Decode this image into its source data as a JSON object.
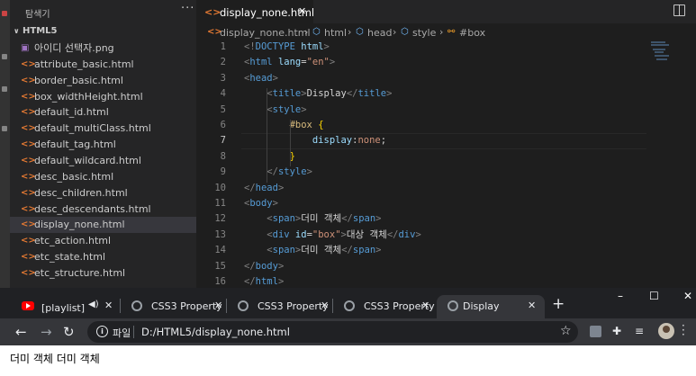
{
  "vscode": {
    "sidebar": {
      "title": "탐색기",
      "more": "···",
      "section": "HTML5",
      "files": [
        {
          "icon": "image-file-icon",
          "name": "아이디 선택자.png"
        },
        {
          "icon": "html-file-icon",
          "name": "attribute_basic.html"
        },
        {
          "icon": "html-file-icon",
          "name": "border_basic.html"
        },
        {
          "icon": "html-file-icon",
          "name": "box_widthHeight.html"
        },
        {
          "icon": "html-file-icon",
          "name": "default_id.html"
        },
        {
          "icon": "html-file-icon",
          "name": "default_multiClass.html"
        },
        {
          "icon": "html-file-icon",
          "name": "default_tag.html"
        },
        {
          "icon": "html-file-icon",
          "name": "default_wildcard.html"
        },
        {
          "icon": "html-file-icon",
          "name": "desc_basic.html"
        },
        {
          "icon": "html-file-icon",
          "name": "desc_children.html"
        },
        {
          "icon": "html-file-icon",
          "name": "desc_descendants.html"
        },
        {
          "icon": "html-file-icon",
          "name": "display_none.html",
          "selected": true
        },
        {
          "icon": "html-file-icon",
          "name": "etc_action.html"
        },
        {
          "icon": "html-file-icon",
          "name": "etc_state.html"
        },
        {
          "icon": "html-file-icon",
          "name": "etc_structure.html"
        }
      ]
    },
    "tab": {
      "label": "display_none.html",
      "close": "✕"
    },
    "breadcrumb": [
      "display_none.html",
      "html",
      "head",
      "style",
      "#box"
    ],
    "current_line": 7,
    "code": [
      {
        "n": "1",
        "tokens": [
          [
            "t-bracket",
            "<!"
          ],
          [
            "t-tag",
            "DOCTYPE"
          ],
          [
            "t-text",
            " "
          ],
          [
            "t-attr",
            "html"
          ],
          [
            "t-bracket",
            ">"
          ]
        ]
      },
      {
        "n": "2",
        "tokens": [
          [
            "t-bracket",
            "<"
          ],
          [
            "t-tag",
            "html"
          ],
          [
            "t-text",
            " "
          ],
          [
            "t-attr",
            "lang"
          ],
          [
            "t-text",
            "="
          ],
          [
            "t-str",
            "\"en\""
          ],
          [
            "t-bracket",
            ">"
          ]
        ]
      },
      {
        "n": "3",
        "tokens": [
          [
            "t-bracket",
            "<"
          ],
          [
            "t-tag",
            "head"
          ],
          [
            "t-bracket",
            ">"
          ]
        ]
      },
      {
        "n": "4",
        "tokens": [
          [
            "t-text",
            "    "
          ],
          [
            "t-bracket",
            "<"
          ],
          [
            "t-tag",
            "title"
          ],
          [
            "t-bracket",
            ">"
          ],
          [
            "t-text",
            "Display"
          ],
          [
            "t-bracket",
            "</"
          ],
          [
            "t-tag",
            "title"
          ],
          [
            "t-bracket",
            ">"
          ]
        ]
      },
      {
        "n": "5",
        "tokens": [
          [
            "t-text",
            "    "
          ],
          [
            "t-bracket",
            "<"
          ],
          [
            "t-tag",
            "style"
          ],
          [
            "t-bracket",
            ">"
          ]
        ]
      },
      {
        "n": "6",
        "tokens": [
          [
            "t-text",
            "        "
          ],
          [
            "t-sel",
            "#box"
          ],
          [
            "t-text",
            " "
          ],
          [
            "t-brace",
            "{"
          ]
        ]
      },
      {
        "n": "7",
        "tokens": [
          [
            "t-text",
            "            "
          ],
          [
            "t-prop",
            "display"
          ],
          [
            "t-text",
            ":"
          ],
          [
            "t-val",
            "none"
          ],
          [
            "t-text",
            ";"
          ]
        ]
      },
      {
        "n": "8",
        "tokens": [
          [
            "t-text",
            "        "
          ],
          [
            "t-brace",
            "}"
          ]
        ]
      },
      {
        "n": "9",
        "tokens": [
          [
            "t-text",
            "    "
          ],
          [
            "t-bracket",
            "</"
          ],
          [
            "t-tag",
            "style"
          ],
          [
            "t-bracket",
            ">"
          ]
        ]
      },
      {
        "n": "10",
        "tokens": [
          [
            "t-bracket",
            "</"
          ],
          [
            "t-tag",
            "head"
          ],
          [
            "t-bracket",
            ">"
          ]
        ]
      },
      {
        "n": "11",
        "tokens": [
          [
            "t-bracket",
            "<"
          ],
          [
            "t-tag",
            "body"
          ],
          [
            "t-bracket",
            ">"
          ]
        ]
      },
      {
        "n": "12",
        "tokens": [
          [
            "t-text",
            "    "
          ],
          [
            "t-bracket",
            "<"
          ],
          [
            "t-tag",
            "span"
          ],
          [
            "t-bracket",
            ">"
          ],
          [
            "t-text",
            "더미 객체"
          ],
          [
            "t-bracket",
            "</"
          ],
          [
            "t-tag",
            "span"
          ],
          [
            "t-bracket",
            ">"
          ]
        ]
      },
      {
        "n": "13",
        "tokens": [
          [
            "t-text",
            "    "
          ],
          [
            "t-bracket",
            "<"
          ],
          [
            "t-tag",
            "div"
          ],
          [
            "t-text",
            " "
          ],
          [
            "t-attr",
            "id"
          ],
          [
            "t-text",
            "="
          ],
          [
            "t-str",
            "\"box\""
          ],
          [
            "t-bracket",
            ">"
          ],
          [
            "t-text",
            "대상 객체"
          ],
          [
            "t-bracket",
            "</"
          ],
          [
            "t-tag",
            "div"
          ],
          [
            "t-bracket",
            ">"
          ]
        ]
      },
      {
        "n": "14",
        "tokens": [
          [
            "t-text",
            "    "
          ],
          [
            "t-bracket",
            "<"
          ],
          [
            "t-tag",
            "span"
          ],
          [
            "t-bracket",
            ">"
          ],
          [
            "t-text",
            "더미 객체"
          ],
          [
            "t-bracket",
            "</"
          ],
          [
            "t-tag",
            "span"
          ],
          [
            "t-bracket",
            ">"
          ]
        ]
      },
      {
        "n": "15",
        "tokens": [
          [
            "t-bracket",
            "</"
          ],
          [
            "t-tag",
            "body"
          ],
          [
            "t-bracket",
            ">"
          ]
        ]
      },
      {
        "n": "16",
        "tokens": [
          [
            "t-bracket",
            "</"
          ],
          [
            "t-tag",
            "html"
          ],
          [
            "t-bracket",
            ">"
          ]
        ]
      }
    ]
  },
  "browser": {
    "tabs": [
      {
        "label": "[playlist] *조",
        "favicon": "youtube-icon",
        "active": false
      },
      {
        "label": "CSS3 Property",
        "favicon": "globe-icon",
        "active": false
      },
      {
        "label": "CSS3 Property",
        "favicon": "globe-icon",
        "active": false
      },
      {
        "label": "CSS3 Property",
        "favicon": "globe-icon",
        "active": false
      },
      {
        "label": "Display",
        "favicon": "globe-icon",
        "active": true
      }
    ],
    "new_tab": "+",
    "window_controls": {
      "minimize": "–",
      "maximize": "☐",
      "close": "✕"
    },
    "omnibox": {
      "scheme_label": "파일",
      "url": "D:/HTML5/display_none.html"
    },
    "page_text": "더미 객체 더미 객체"
  },
  "colors": {
    "editor_bg": "#1e1e1e",
    "sidebar_bg": "#252526",
    "selected_row": "#37373d",
    "chrome_bar": "#202124",
    "chrome_toolbar": "#35363a"
  }
}
